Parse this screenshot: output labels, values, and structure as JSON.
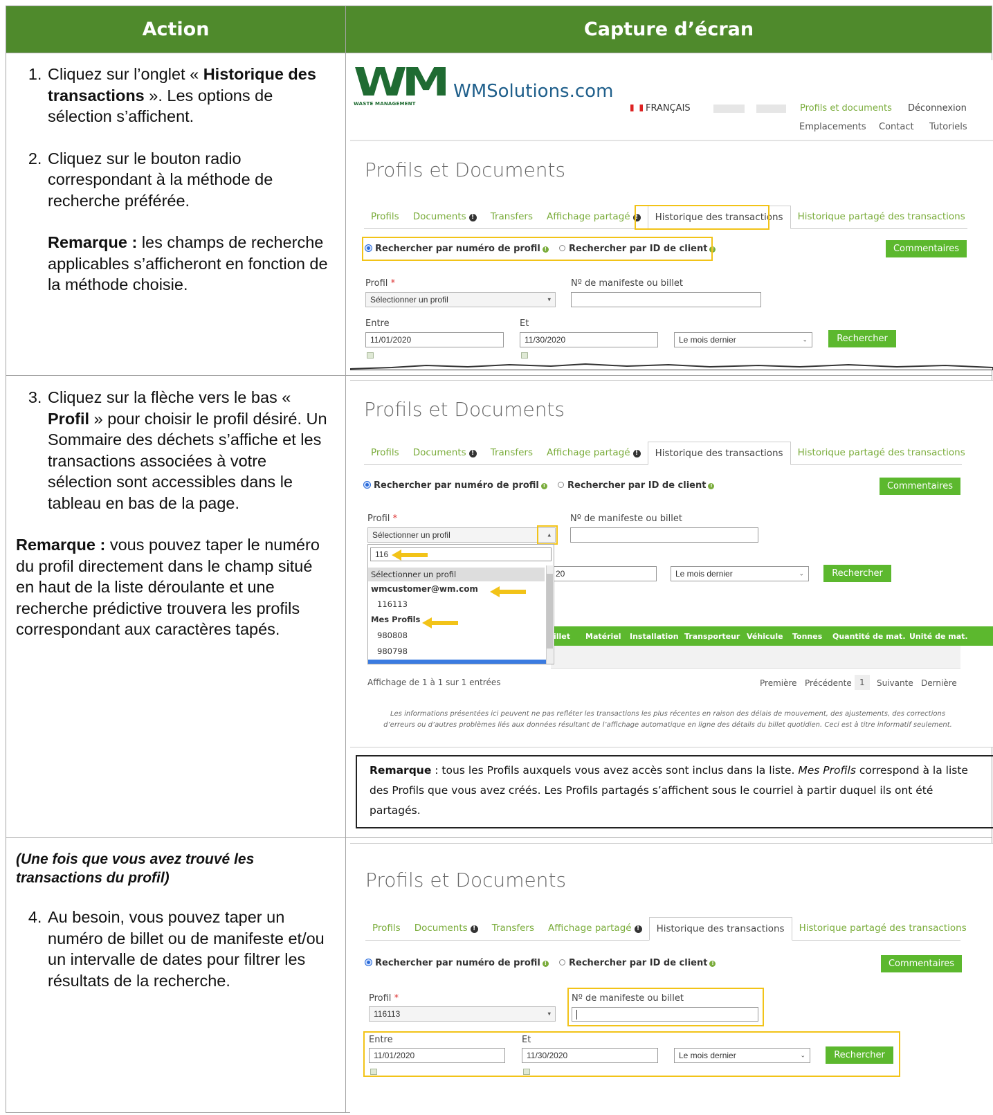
{
  "header": {
    "action": "Action",
    "capture": "Capture d’écran"
  },
  "row1": {
    "step1_pre": "Cliquez sur l’onglet « ",
    "step1_bold": "Historique des transactions",
    "step1_post": " ». Les options de sélection s’affichent.",
    "step2": "Cliquez sur le bouton radio correspondant à la méthode de recherche préférée.",
    "note_bold": "Remarque :",
    "note_text": " les champs de recherche applicables s’afficheront en fonction de la méthode choisie."
  },
  "row2": {
    "step3_pre": "Cliquez sur la flèche vers le bas « ",
    "step3_bold": "Profil",
    "step3_post": " » pour choisir le profil désiré. Un Sommaire des déchets s’affiche et les transactions associées à votre sélection sont accessibles dans le tableau en bas de la page.",
    "note_bold": "Remarque :",
    "note_text": " vous pouvez taper le numéro du profil directement dans le champ situé en haut de la liste déroulante et une recherche prédictive trouvera les profils correspondant aux caractères tapés."
  },
  "row3": {
    "intro": "(Une fois que vous avez trouvé les transactions du profil)",
    "step4": "Au besoin, vous pouvez taper un numéro de billet ou de manifeste et/ou un intervalle de dates pour filtrer les résultats de la recherche."
  },
  "site": {
    "logo_letters": "WM",
    "logo_sub": "WASTE MANAGEMENT",
    "domain": "WMSolutions.com",
    "lang": "FRANÇAIS",
    "nav_profiles": "Profils et documents",
    "nav_logout": "Déconnexion",
    "nav_locations": "Emplacements",
    "nav_contact": "Contact",
    "nav_tutorials": "Tutoriels"
  },
  "app": {
    "title": "Profils et Documents",
    "tabs": [
      "Profils",
      "Documents",
      "Transfers",
      "Affichage partagé",
      "Historique des transactions",
      "Historique partagé des transactions"
    ],
    "radio_profile": "Rechercher par numéro de profil",
    "radio_client": "Rechercher par ID de client",
    "comments_btn": "Commentaires",
    "profile_label": "Profil",
    "required_mark": "*",
    "manifest_label": "Nº de manifeste ou billet",
    "between_label": "Entre",
    "and_label": "Et",
    "date_from": "11/01/2020",
    "date_to": "11/30/2020",
    "period": "Le mois dernier",
    "search_btn": "Rechercher",
    "select_placeholder": "Sélectionner un profil"
  },
  "dropdown": {
    "search_value": "116",
    "items": [
      "Sélectionner un profil",
      "wmcustomer@wm.com",
      "116113",
      "Mes Profils",
      "980808",
      "980798"
    ]
  },
  "table": {
    "columns": [
      "illet",
      "Matériel",
      "Installation",
      "Transporteur",
      "Véhicule",
      "Tonnes",
      "Quantité de mat.",
      "Unité de mat."
    ],
    "showing": "Affichage de 1 à 1 sur 1 entrées",
    "pager": [
      "Première",
      "Précédente",
      "1",
      "Suivante",
      "Dernière"
    ],
    "partial_date": "20",
    "disclaimer": "Les informations présentées ici peuvent ne pas refléter les transactions les plus récentes en raison des délais de mouvement, des ajustements, des corrections d’erreurs ou d’autres problèmes liés aux données résultant de l’affichage automatique en ligne des détails du billet quotidien. Ceci est à titre informatif seulement."
  },
  "remark_box": {
    "bold": "Remarque",
    "t1": " : tous les Profils auxquels vous avez accès sont inclus dans la liste. ",
    "italic": "Mes Profils",
    "t2": " correspond à la liste des Profils que vous avez créés. Les Profils partagés s’affichent sous le courriel à partir duquel ils ont été partagés."
  },
  "shot3": {
    "profile_value": "116113"
  },
  "colors": {
    "header_green": "#4f8a2c",
    "button_green": "#5cb82e",
    "link_green": "#7aac3b",
    "highlight": "#f2c318"
  }
}
